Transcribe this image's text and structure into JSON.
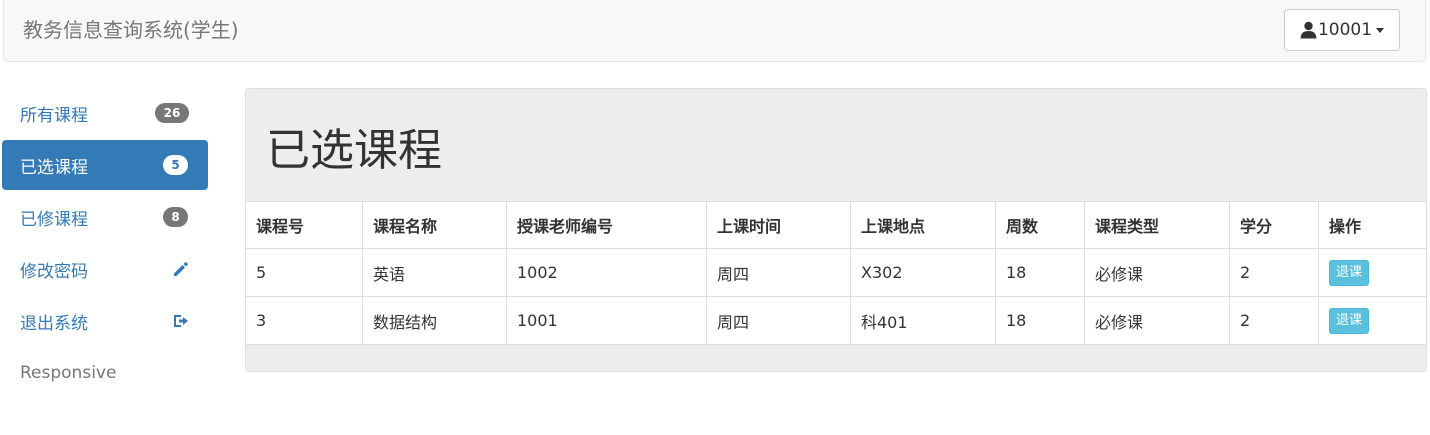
{
  "app": {
    "title": "教务信息查询系统(学生)"
  },
  "user_menu": {
    "username": "10001"
  },
  "sidebar": {
    "items": [
      {
        "label": "所有课程",
        "badge": "26"
      },
      {
        "label": "已选课程",
        "badge": "5"
      },
      {
        "label": "已修课程",
        "badge": "8"
      },
      {
        "label": "修改密码",
        "icon": "pencil-icon"
      },
      {
        "label": "退出系统",
        "icon": "logout-icon"
      }
    ],
    "footer_text": "Responsive"
  },
  "main": {
    "heading": "已选课程",
    "table": {
      "headers": [
        "课程号",
        "课程名称",
        "授课老师编号",
        "上课时间",
        "上课地点",
        "周数",
        "课程类型",
        "学分",
        "操作"
      ],
      "rows": [
        {
          "id": "5",
          "name": "英语",
          "teacher_id": "1002",
          "time": "周四",
          "location": "X302",
          "weeks": "18",
          "type": "必修课",
          "credits": "2",
          "action": "退课"
        },
        {
          "id": "3",
          "name": "数据结构",
          "teacher_id": "1001",
          "time": "周四",
          "location": "科401",
          "weeks": "18",
          "type": "必修课",
          "credits": "2",
          "action": "退课"
        }
      ]
    }
  },
  "colors": {
    "primary": "#337ab7",
    "info_button": "#5bc0de",
    "badge": "#777777"
  }
}
